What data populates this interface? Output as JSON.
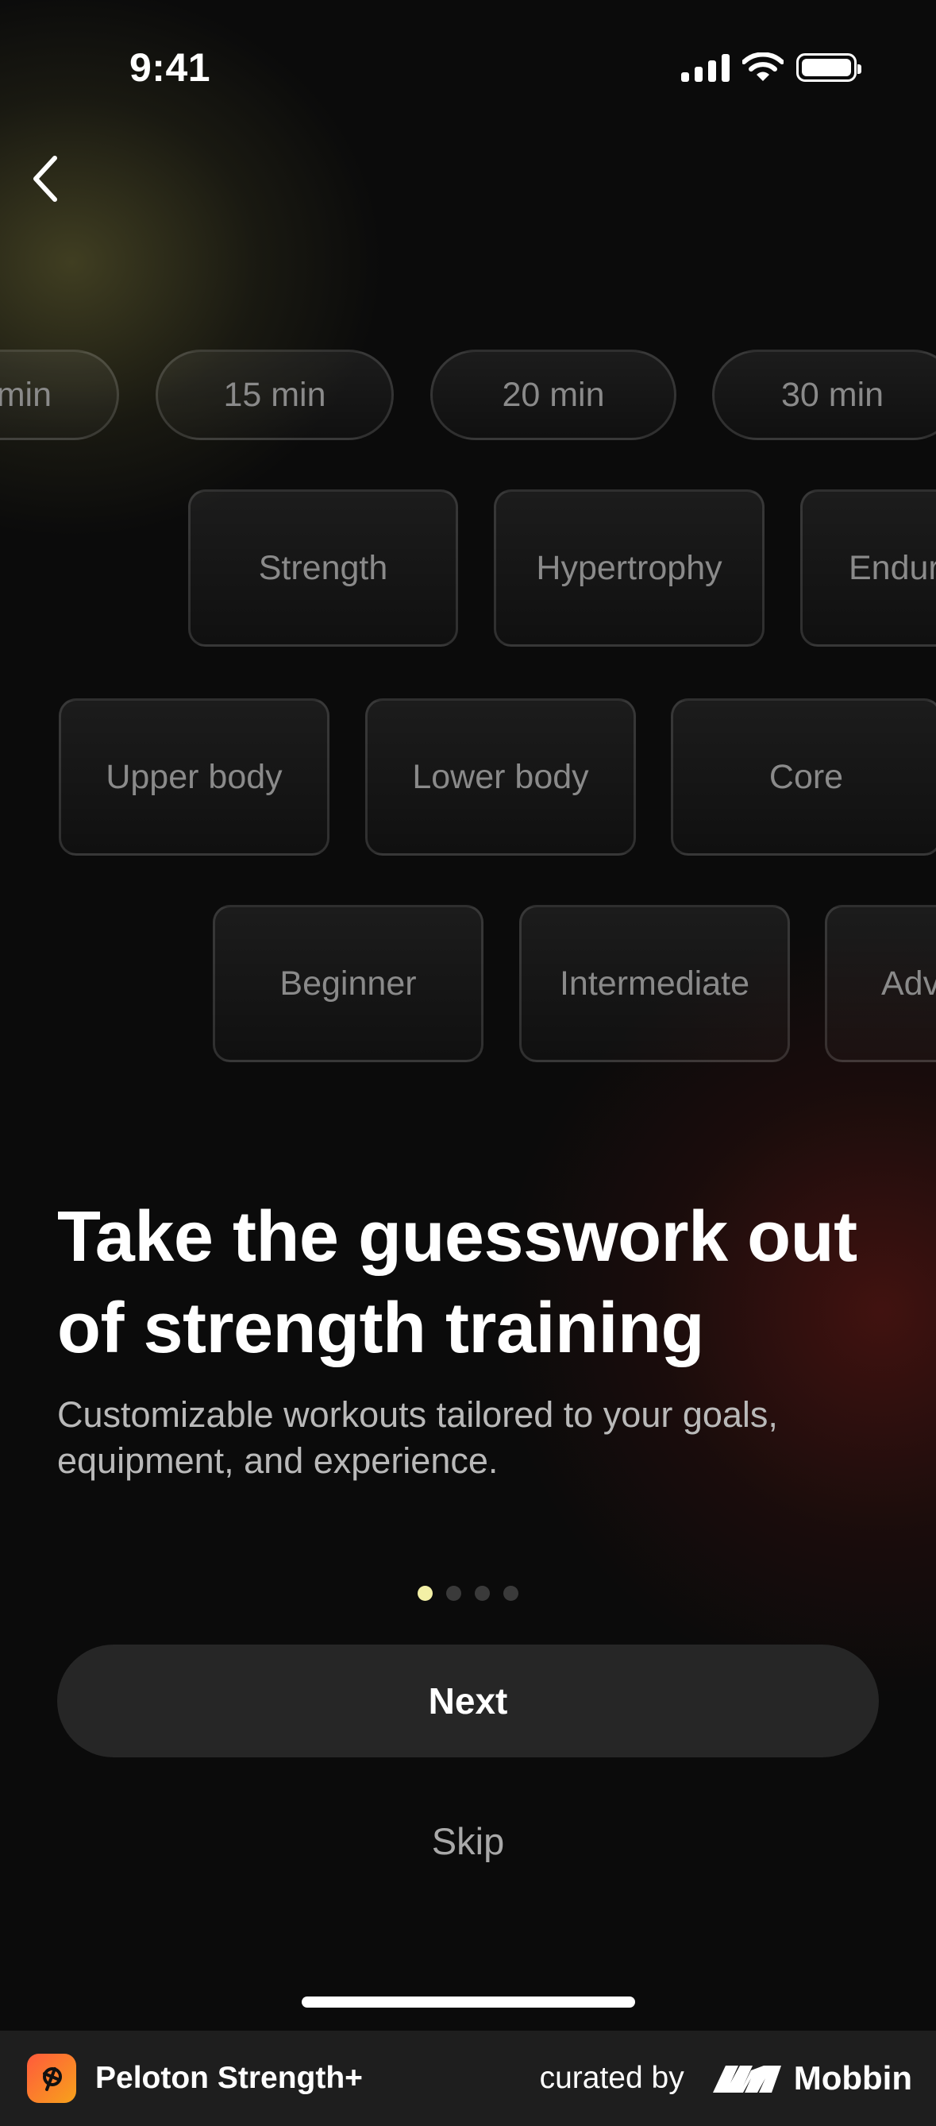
{
  "status_bar": {
    "time": "9:41"
  },
  "chips": {
    "durations": [
      "min",
      "15 min",
      "20 min",
      "30 min"
    ],
    "goals": [
      "Strength",
      "Hypertrophy",
      "Endur"
    ],
    "body_parts": [
      "Upper body",
      "Lower body",
      "Core"
    ],
    "levels": [
      "Beginner",
      "Intermediate",
      "Adv"
    ]
  },
  "onboarding": {
    "headline": "Take the guesswork out of strength training",
    "subtext": "Customizable workouts tailored to your goals, equipment, and experience.",
    "page_count": 4,
    "current_page": 1,
    "next_label": "Next",
    "skip_label": "Skip"
  },
  "footer": {
    "app_name": "Peloton Strength+",
    "curated_by": "curated by",
    "brand": "Mobbin"
  },
  "colors": {
    "background": "#0b0b0b",
    "button": "#262626",
    "active_dot": "#f3f0a6",
    "inactive_dot": "#3a3a3a",
    "chip_text": "#8a8a8a"
  },
  "icons": [
    "chevron-left-icon",
    "cellular-signal-icon",
    "wifi-icon",
    "battery-icon",
    "peloton-logo-icon",
    "mobbin-logo-icon"
  ]
}
